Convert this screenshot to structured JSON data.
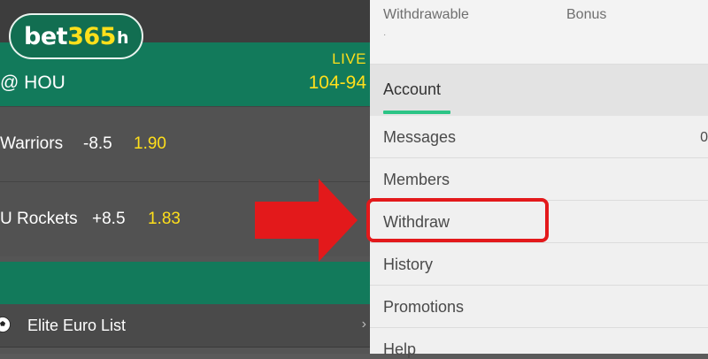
{
  "logo": {
    "brand": "bet",
    "number": "365",
    "suffix": "h"
  },
  "match": {
    "status": "LIVE",
    "teams": "@ HOU",
    "score": "104-94"
  },
  "bets": [
    {
      "team": "Warriors",
      "line": "-8.5",
      "odds": "1.90"
    },
    {
      "team": "U Rockets",
      "line": "+8.5",
      "odds": "1.83"
    }
  ],
  "sports_list": {
    "item": "Elite Euro List"
  },
  "account_panel": {
    "balances": {
      "withdrawable_label": "Withdrawable",
      "bonus_label": "Bonus"
    },
    "tab": "Account",
    "menu": [
      {
        "label": "Messages",
        "count": "0"
      },
      {
        "label": "Members"
      },
      {
        "label": "Withdraw"
      },
      {
        "label": "History"
      },
      {
        "label": "Promotions"
      },
      {
        "label": "Help"
      }
    ]
  },
  "colors": {
    "brand_green": "#127a5b",
    "odds_yellow": "#ffdf1b",
    "tab_accent": "#2cc486",
    "callout_red": "#e3191b"
  }
}
